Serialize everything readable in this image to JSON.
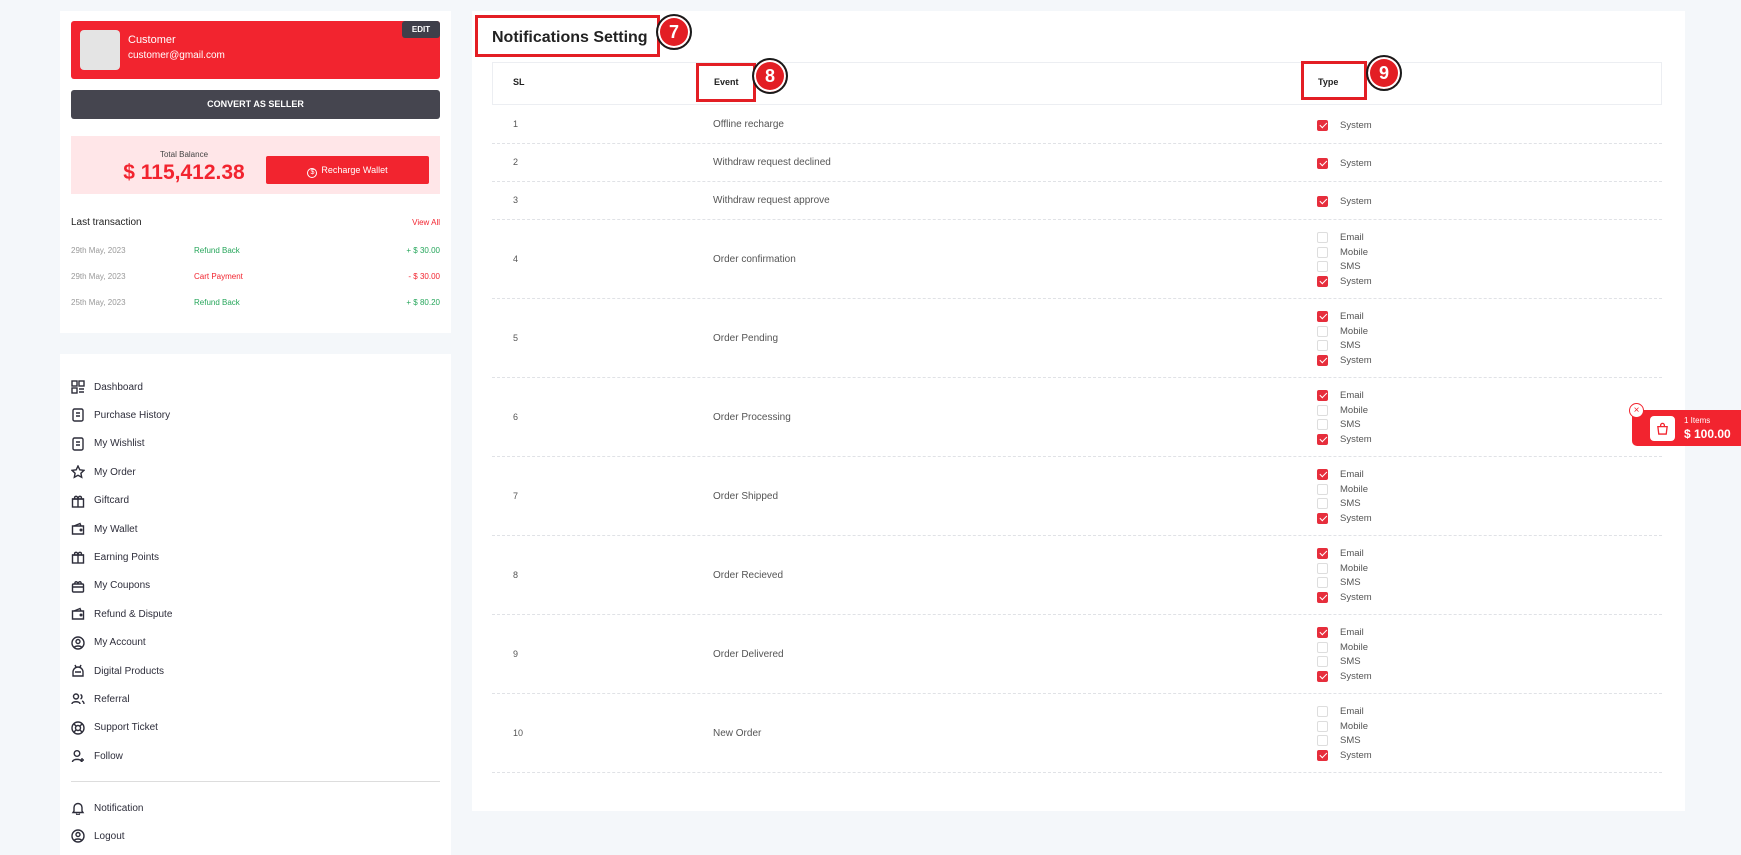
{
  "profile": {
    "name": "Customer",
    "email": "customer@gmail.com",
    "edit_label": "EDIT",
    "convert_label": "CONVERT AS SELLER"
  },
  "wallet": {
    "balance_label": "Total Balance",
    "balance": "$ 115,412.38",
    "recharge_label": "Recharge Wallet",
    "last_transaction_label": "Last transaction",
    "view_all_label": "View All",
    "transactions": [
      {
        "date": "29th May, 2023",
        "type": "Refund Back",
        "amount": "+ $ 30.00",
        "tone": "green"
      },
      {
        "date": "29th May, 2023",
        "type": "Cart Payment",
        "amount": "- $ 30.00",
        "tone": "red"
      },
      {
        "date": "25th May, 2023",
        "type": "Refund Back",
        "amount": "+ $ 80.20",
        "tone": "green"
      }
    ]
  },
  "menu": {
    "items": [
      {
        "label": "Dashboard",
        "icon": "dashboard-icon"
      },
      {
        "label": "Purchase History",
        "icon": "purchase-history-icon"
      },
      {
        "label": "My Wishlist",
        "icon": "wishlist-icon"
      },
      {
        "label": "My Order",
        "icon": "star-icon"
      },
      {
        "label": "Giftcard",
        "icon": "giftcard-icon"
      },
      {
        "label": "My Wallet",
        "icon": "wallet-icon"
      },
      {
        "label": "Earning Points",
        "icon": "gift-icon"
      },
      {
        "label": "My Coupons",
        "icon": "coupon-icon"
      },
      {
        "label": "Refund & Dispute",
        "icon": "refund-icon"
      },
      {
        "label": "My Account",
        "icon": "user-circle-icon"
      },
      {
        "label": "Digital Products",
        "icon": "digital-products-icon"
      },
      {
        "label": "Referral",
        "icon": "referral-icon"
      },
      {
        "label": "Support Ticket",
        "icon": "support-icon"
      },
      {
        "label": "Follow",
        "icon": "follow-icon"
      }
    ],
    "bottom_items": [
      {
        "label": "Notification",
        "icon": "bell-icon"
      },
      {
        "label": "Logout",
        "icon": "logout-icon"
      }
    ]
  },
  "main": {
    "title": "Notifications Setting",
    "columns": {
      "sl": "SL",
      "event": "Event",
      "type": "Type"
    },
    "badges": {
      "title": "7",
      "event": "8",
      "type": "9"
    },
    "type_labels": {
      "email": "Email",
      "mobile": "Mobile",
      "sms": "SMS",
      "system": "System"
    },
    "rows": [
      {
        "sl": "1",
        "event": "Offline recharge",
        "types": [
          {
            "label": "System",
            "checked": true
          }
        ]
      },
      {
        "sl": "2",
        "event": "Withdraw request declined",
        "types": [
          {
            "label": "System",
            "checked": true
          }
        ]
      },
      {
        "sl": "3",
        "event": "Withdraw request approve",
        "types": [
          {
            "label": "System",
            "checked": true
          }
        ]
      },
      {
        "sl": "4",
        "event": "Order confirmation",
        "types": [
          {
            "label": "Email",
            "checked": false
          },
          {
            "label": "Mobile",
            "checked": false
          },
          {
            "label": "SMS",
            "checked": false
          },
          {
            "label": "System",
            "checked": true
          }
        ]
      },
      {
        "sl": "5",
        "event": "Order Pending",
        "types": [
          {
            "label": "Email",
            "checked": true
          },
          {
            "label": "Mobile",
            "checked": false
          },
          {
            "label": "SMS",
            "checked": false
          },
          {
            "label": "System",
            "checked": true
          }
        ]
      },
      {
        "sl": "6",
        "event": "Order Processing",
        "types": [
          {
            "label": "Email",
            "checked": true
          },
          {
            "label": "Mobile",
            "checked": false
          },
          {
            "label": "SMS",
            "checked": false
          },
          {
            "label": "System",
            "checked": true
          }
        ]
      },
      {
        "sl": "7",
        "event": "Order Shipped",
        "types": [
          {
            "label": "Email",
            "checked": true
          },
          {
            "label": "Mobile",
            "checked": false
          },
          {
            "label": "SMS",
            "checked": false
          },
          {
            "label": "System",
            "checked": true
          }
        ]
      },
      {
        "sl": "8",
        "event": "Order Recieved",
        "types": [
          {
            "label": "Email",
            "checked": true
          },
          {
            "label": "Mobile",
            "checked": false
          },
          {
            "label": "SMS",
            "checked": false
          },
          {
            "label": "System",
            "checked": true
          }
        ]
      },
      {
        "sl": "9",
        "event": "Order Delivered",
        "types": [
          {
            "label": "Email",
            "checked": true
          },
          {
            "label": "Mobile",
            "checked": false
          },
          {
            "label": "SMS",
            "checked": false
          },
          {
            "label": "System",
            "checked": true
          }
        ]
      },
      {
        "sl": "10",
        "event": "New Order",
        "types": [
          {
            "label": "Email",
            "checked": false
          },
          {
            "label": "Mobile",
            "checked": false
          },
          {
            "label": "SMS",
            "checked": false
          },
          {
            "label": "System",
            "checked": true
          }
        ]
      }
    ]
  },
  "cart": {
    "items_label": "1 Items",
    "total": "$ 100.00"
  },
  "colors": {
    "accent": "#f2242f",
    "dark": "#45454f",
    "highlight": "#e31e24"
  }
}
